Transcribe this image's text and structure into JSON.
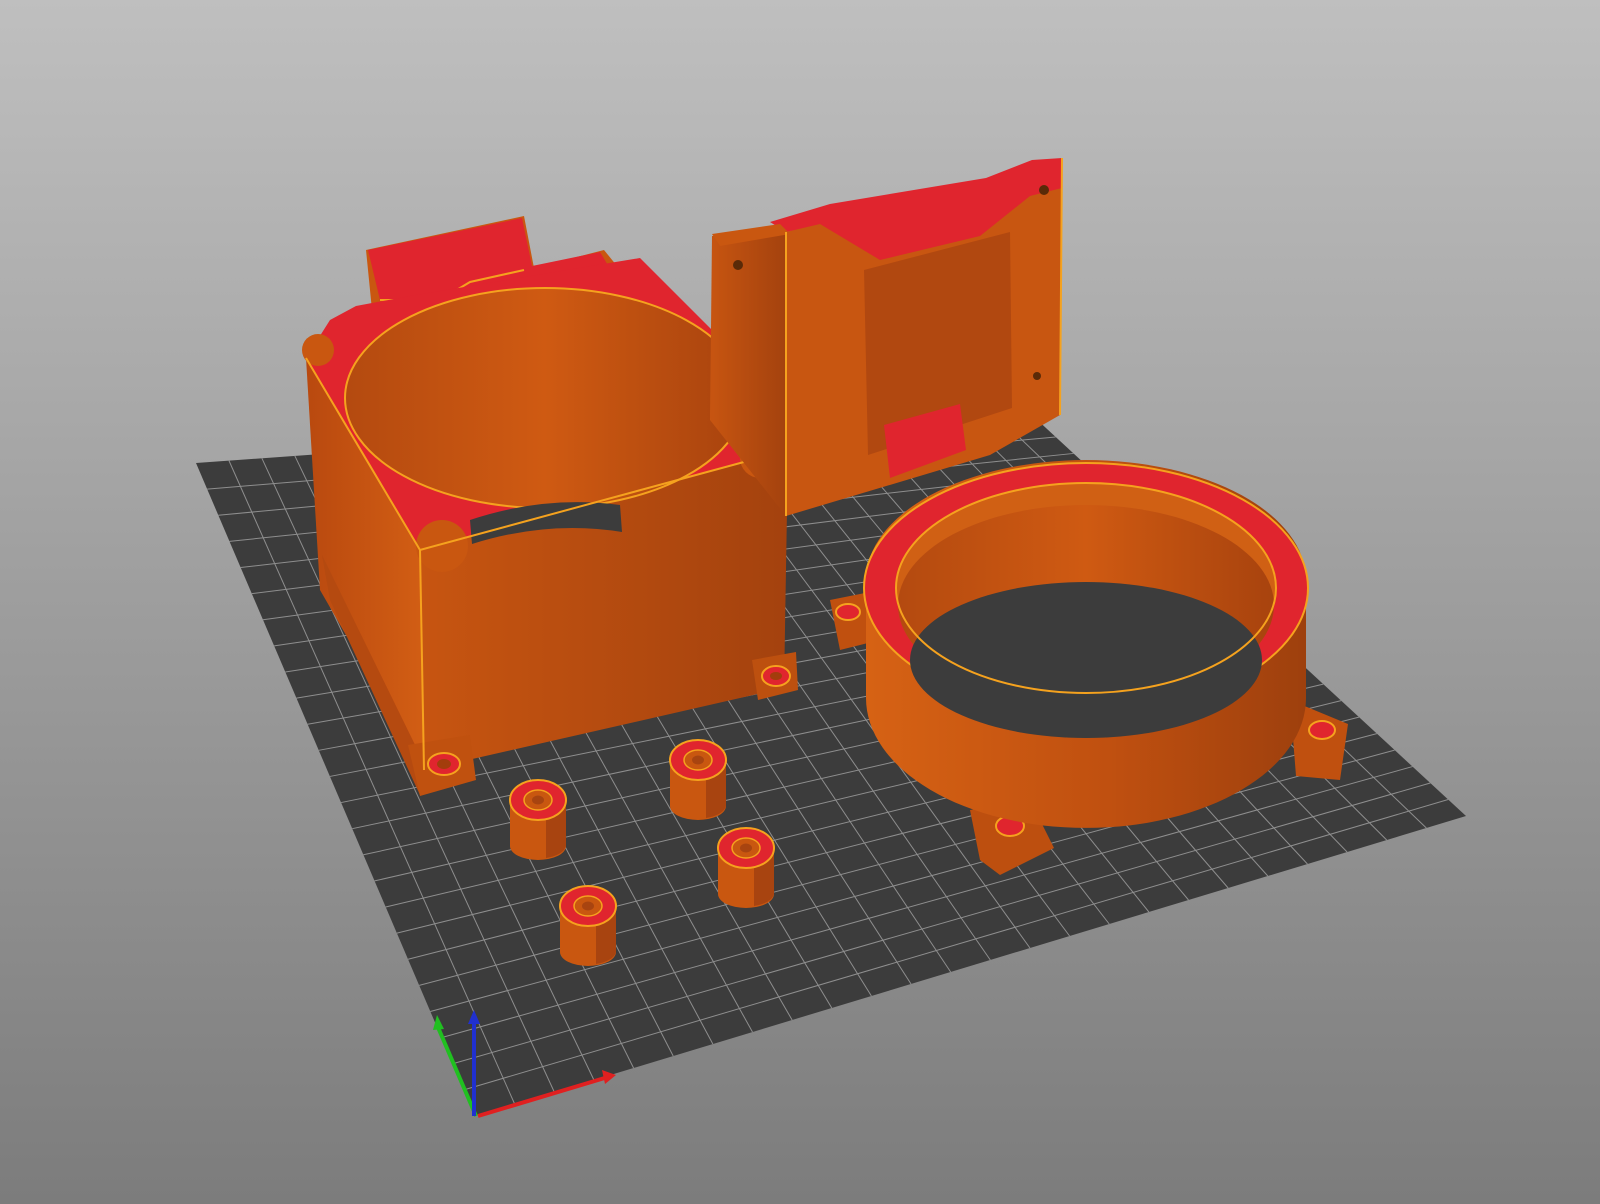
{
  "viewport": {
    "background_top": "#bfbfbf",
    "background_bottom": "#7c7c7c"
  },
  "bed": {
    "color": "#3c3c3c",
    "grid_color": "#8e8e8e"
  },
  "colors": {
    "perimeter": "#c95710",
    "perimeter_dark": "#a84410",
    "top_solid": "#e0252e",
    "edge": "#f5a21e"
  },
  "axes": {
    "x_color": "#e02020",
    "y_color": "#20c020",
    "z_color": "#2030d0"
  },
  "icons": [
    "axis-gizmo-icon"
  ]
}
